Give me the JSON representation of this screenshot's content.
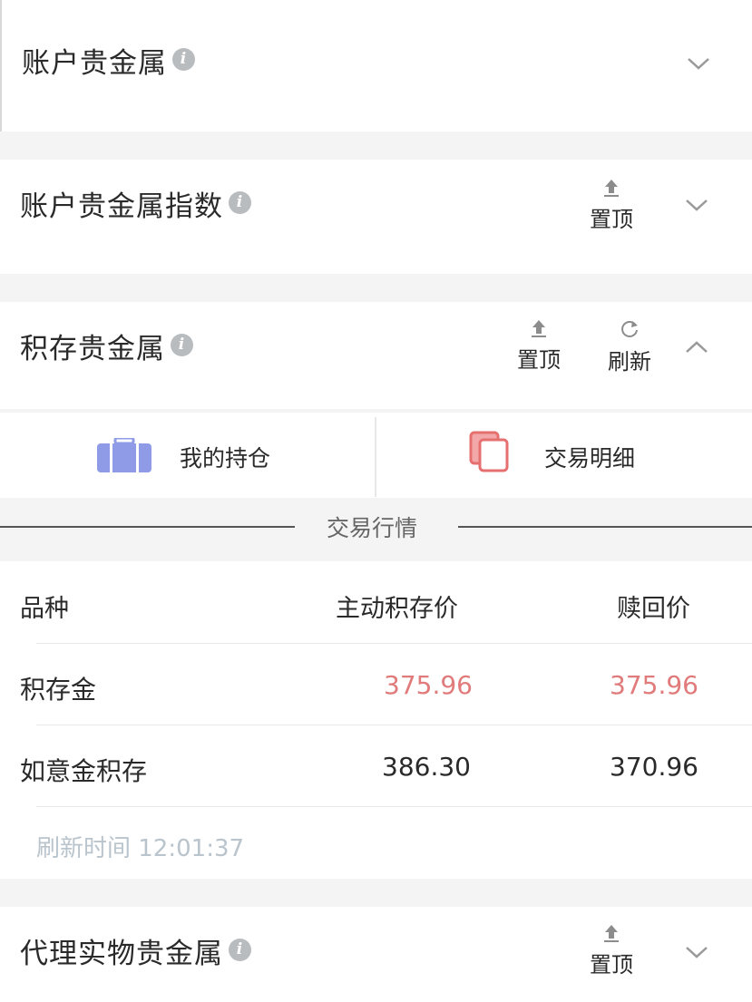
{
  "sections": {
    "account_metal": {
      "title": "账户贵金属"
    },
    "account_metal_index": {
      "title": "账户贵金属指数",
      "pin_label": "置顶"
    },
    "accumulation_metal": {
      "title": "积存贵金属",
      "pin_label": "置顶",
      "refresh_label": "刷新"
    },
    "agency_physical_metal": {
      "title": "代理实物贵金属",
      "pin_label": "置顶"
    }
  },
  "tiles": {
    "holdings": {
      "label": "我的持仓",
      "icon": "briefcase-icon",
      "color": "#8f9be6"
    },
    "details": {
      "label": "交易明细",
      "icon": "copy-icon",
      "color": "#e66f6f"
    }
  },
  "market": {
    "heading": "交易行情",
    "columns": [
      "品种",
      "主动积存价",
      "赎回价"
    ],
    "rows": [
      {
        "name": "积存金",
        "accumulate_price": "375.96",
        "redeem_price": "375.96",
        "highlight": true
      },
      {
        "name": "如意金积存",
        "accumulate_price": "386.30",
        "redeem_price": "370.96",
        "highlight": false
      }
    ],
    "refresh_time": "刷新时间 12:01:37"
  },
  "colors": {
    "accent_red": "#e17b7b",
    "muted": "#b9c4cc"
  }
}
